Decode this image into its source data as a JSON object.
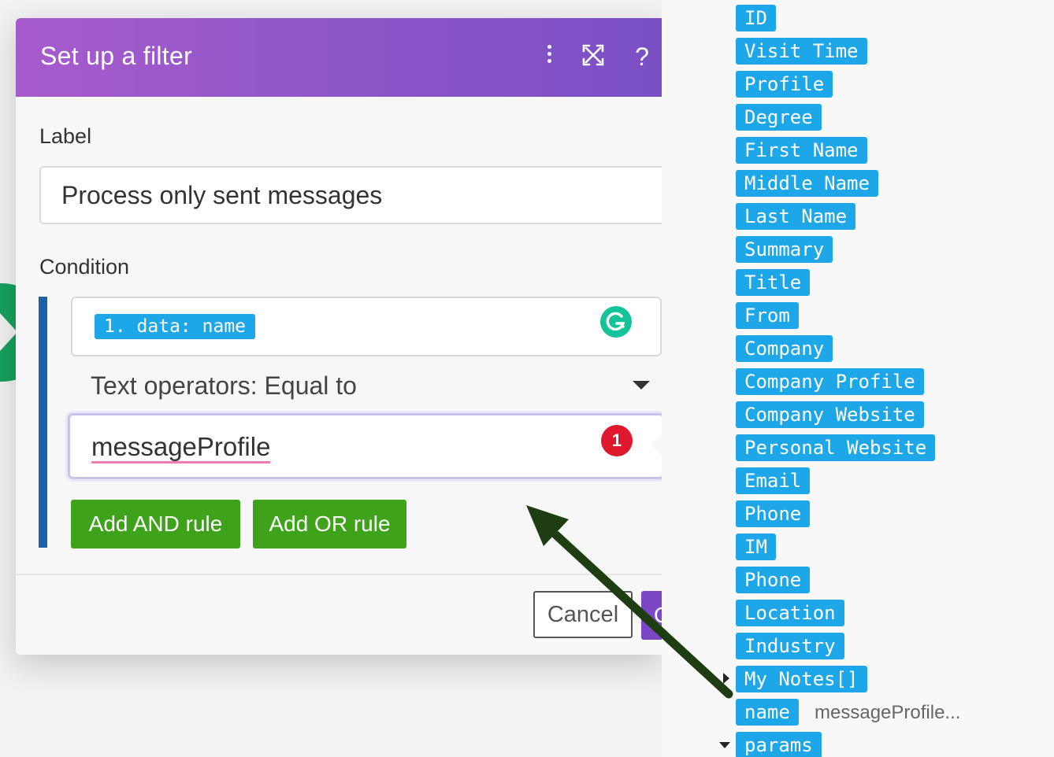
{
  "dialog": {
    "title": "Set up a filter",
    "header_icons": [
      "more-vertical-icon",
      "expand-icon",
      "help-icon"
    ],
    "help_glyph": "?",
    "label_title": "Label",
    "label_value": "Process only sent messages",
    "condition_title": "Condition",
    "operand_tag": "1. data: name",
    "operator": "Text operators: Equal to",
    "value": "messageProfile",
    "error_count": "1",
    "add_and_label": "Add AND rule",
    "add_or_label": "Add OR rule",
    "cancel_label": "Cancel",
    "ok_label": "OK"
  },
  "data_tree": {
    "items": [
      {
        "label": "ID"
      },
      {
        "label": "Visit Time"
      },
      {
        "label": "Profile"
      },
      {
        "label": "Degree"
      },
      {
        "label": "First Name"
      },
      {
        "label": "Middle Name"
      },
      {
        "label": "Last Name"
      },
      {
        "label": "Summary"
      },
      {
        "label": "Title"
      },
      {
        "label": "From"
      },
      {
        "label": "Company"
      },
      {
        "label": "Company Profile"
      },
      {
        "label": "Company Website"
      },
      {
        "label": "Personal Website"
      },
      {
        "label": "Email"
      },
      {
        "label": "Phone"
      },
      {
        "label": "IM"
      },
      {
        "label": "Phone"
      },
      {
        "label": "Location"
      },
      {
        "label": "Industry"
      },
      {
        "label": "My Notes[]"
      },
      {
        "label": "name"
      },
      {
        "label": "params"
      }
    ],
    "name_value": "messageProfile..."
  },
  "colors": {
    "header_gradient_start": "#a65bcc",
    "header_gradient_end": "#7a4fc4",
    "tag_blue": "#1ea7e8",
    "button_green": "#3ea21a",
    "error_red": "#e0182d",
    "arrow_green": "#1f3d12"
  }
}
